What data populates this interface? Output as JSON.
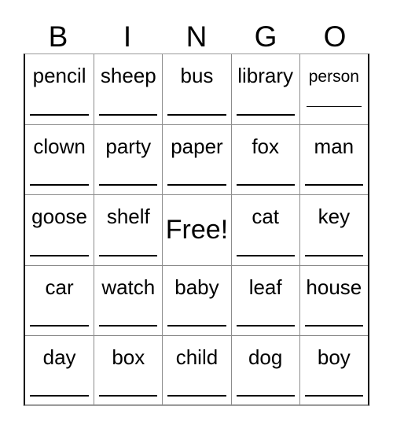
{
  "card": {
    "title_letters": [
      "B",
      "I",
      "N",
      "G",
      "O"
    ],
    "free_label": "Free!",
    "grid": [
      [
        {
          "word": "pencil",
          "size": "normal",
          "line": true
        },
        {
          "word": "sheep",
          "size": "normal",
          "line": true
        },
        {
          "word": "bus",
          "size": "normal",
          "line": true
        },
        {
          "word": "library",
          "size": "normal",
          "line": true
        },
        {
          "word": "person",
          "size": "small",
          "line": true
        }
      ],
      [
        {
          "word": "clown",
          "size": "normal",
          "line": true
        },
        {
          "word": "party",
          "size": "normal",
          "line": true
        },
        {
          "word": "paper",
          "size": "normal",
          "line": true
        },
        {
          "word": "fox",
          "size": "normal",
          "line": true
        },
        {
          "word": "man",
          "size": "normal",
          "line": true
        }
      ],
      [
        {
          "word": "goose",
          "size": "normal",
          "line": true
        },
        {
          "word": "shelf",
          "size": "normal",
          "line": true
        },
        {
          "word": "Free!",
          "size": "free",
          "line": false
        },
        {
          "word": "cat",
          "size": "normal",
          "line": true
        },
        {
          "word": "key",
          "size": "normal",
          "line": true
        }
      ],
      [
        {
          "word": "car",
          "size": "normal",
          "line": true
        },
        {
          "word": "watch",
          "size": "normal",
          "line": true
        },
        {
          "word": "baby",
          "size": "normal",
          "line": true
        },
        {
          "word": "leaf",
          "size": "normal",
          "line": true
        },
        {
          "word": "house",
          "size": "normal",
          "line": true
        }
      ],
      [
        {
          "word": "day",
          "size": "normal",
          "line": true
        },
        {
          "word": "box",
          "size": "normal",
          "line": true
        },
        {
          "word": "child",
          "size": "normal",
          "line": true
        },
        {
          "word": "dog",
          "size": "normal",
          "line": true
        },
        {
          "word": "boy",
          "size": "normal",
          "line": true
        }
      ]
    ],
    "colors": {
      "text": "#000000",
      "background": "#ffffff",
      "grid_line": "#8c8c8c",
      "outer_border": "#000000",
      "write_line": "#000000"
    }
  }
}
